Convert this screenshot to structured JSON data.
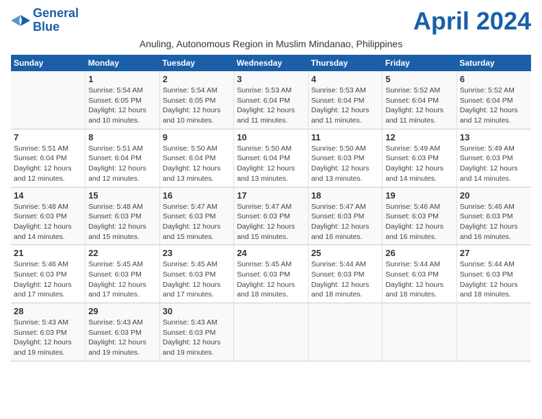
{
  "header": {
    "logo_line1": "General",
    "logo_line2": "Blue",
    "month_title": "April 2024",
    "subtitle": "Anuling, Autonomous Region in Muslim Mindanao, Philippines"
  },
  "weekdays": [
    "Sunday",
    "Monday",
    "Tuesday",
    "Wednesday",
    "Thursday",
    "Friday",
    "Saturday"
  ],
  "weeks": [
    [
      {
        "day": "",
        "sunrise": "",
        "sunset": "",
        "daylight": ""
      },
      {
        "day": "1",
        "sunrise": "Sunrise: 5:54 AM",
        "sunset": "Sunset: 6:05 PM",
        "daylight": "Daylight: 12 hours and 10 minutes."
      },
      {
        "day": "2",
        "sunrise": "Sunrise: 5:54 AM",
        "sunset": "Sunset: 6:05 PM",
        "daylight": "Daylight: 12 hours and 10 minutes."
      },
      {
        "day": "3",
        "sunrise": "Sunrise: 5:53 AM",
        "sunset": "Sunset: 6:04 PM",
        "daylight": "Daylight: 12 hours and 11 minutes."
      },
      {
        "day": "4",
        "sunrise": "Sunrise: 5:53 AM",
        "sunset": "Sunset: 6:04 PM",
        "daylight": "Daylight: 12 hours and 11 minutes."
      },
      {
        "day": "5",
        "sunrise": "Sunrise: 5:52 AM",
        "sunset": "Sunset: 6:04 PM",
        "daylight": "Daylight: 12 hours and 11 minutes."
      },
      {
        "day": "6",
        "sunrise": "Sunrise: 5:52 AM",
        "sunset": "Sunset: 6:04 PM",
        "daylight": "Daylight: 12 hours and 12 minutes."
      }
    ],
    [
      {
        "day": "7",
        "sunrise": "Sunrise: 5:51 AM",
        "sunset": "Sunset: 6:04 PM",
        "daylight": "Daylight: 12 hours and 12 minutes."
      },
      {
        "day": "8",
        "sunrise": "Sunrise: 5:51 AM",
        "sunset": "Sunset: 6:04 PM",
        "daylight": "Daylight: 12 hours and 12 minutes."
      },
      {
        "day": "9",
        "sunrise": "Sunrise: 5:50 AM",
        "sunset": "Sunset: 6:04 PM",
        "daylight": "Daylight: 12 hours and 13 minutes."
      },
      {
        "day": "10",
        "sunrise": "Sunrise: 5:50 AM",
        "sunset": "Sunset: 6:04 PM",
        "daylight": "Daylight: 12 hours and 13 minutes."
      },
      {
        "day": "11",
        "sunrise": "Sunrise: 5:50 AM",
        "sunset": "Sunset: 6:03 PM",
        "daylight": "Daylight: 12 hours and 13 minutes."
      },
      {
        "day": "12",
        "sunrise": "Sunrise: 5:49 AM",
        "sunset": "Sunset: 6:03 PM",
        "daylight": "Daylight: 12 hours and 14 minutes."
      },
      {
        "day": "13",
        "sunrise": "Sunrise: 5:49 AM",
        "sunset": "Sunset: 6:03 PM",
        "daylight": "Daylight: 12 hours and 14 minutes."
      }
    ],
    [
      {
        "day": "14",
        "sunrise": "Sunrise: 5:48 AM",
        "sunset": "Sunset: 6:03 PM",
        "daylight": "Daylight: 12 hours and 14 minutes."
      },
      {
        "day": "15",
        "sunrise": "Sunrise: 5:48 AM",
        "sunset": "Sunset: 6:03 PM",
        "daylight": "Daylight: 12 hours and 15 minutes."
      },
      {
        "day": "16",
        "sunrise": "Sunrise: 5:47 AM",
        "sunset": "Sunset: 6:03 PM",
        "daylight": "Daylight: 12 hours and 15 minutes."
      },
      {
        "day": "17",
        "sunrise": "Sunrise: 5:47 AM",
        "sunset": "Sunset: 6:03 PM",
        "daylight": "Daylight: 12 hours and 15 minutes."
      },
      {
        "day": "18",
        "sunrise": "Sunrise: 5:47 AM",
        "sunset": "Sunset: 6:03 PM",
        "daylight": "Daylight: 12 hours and 16 minutes."
      },
      {
        "day": "19",
        "sunrise": "Sunrise: 5:46 AM",
        "sunset": "Sunset: 6:03 PM",
        "daylight": "Daylight: 12 hours and 16 minutes."
      },
      {
        "day": "20",
        "sunrise": "Sunrise: 5:46 AM",
        "sunset": "Sunset: 6:03 PM",
        "daylight": "Daylight: 12 hours and 16 minutes."
      }
    ],
    [
      {
        "day": "21",
        "sunrise": "Sunrise: 5:46 AM",
        "sunset": "Sunset: 6:03 PM",
        "daylight": "Daylight: 12 hours and 17 minutes."
      },
      {
        "day": "22",
        "sunrise": "Sunrise: 5:45 AM",
        "sunset": "Sunset: 6:03 PM",
        "daylight": "Daylight: 12 hours and 17 minutes."
      },
      {
        "day": "23",
        "sunrise": "Sunrise: 5:45 AM",
        "sunset": "Sunset: 6:03 PM",
        "daylight": "Daylight: 12 hours and 17 minutes."
      },
      {
        "day": "24",
        "sunrise": "Sunrise: 5:45 AM",
        "sunset": "Sunset: 6:03 PM",
        "daylight": "Daylight: 12 hours and 18 minutes."
      },
      {
        "day": "25",
        "sunrise": "Sunrise: 5:44 AM",
        "sunset": "Sunset: 6:03 PM",
        "daylight": "Daylight: 12 hours and 18 minutes."
      },
      {
        "day": "26",
        "sunrise": "Sunrise: 5:44 AM",
        "sunset": "Sunset: 6:03 PM",
        "daylight": "Daylight: 12 hours and 18 minutes."
      },
      {
        "day": "27",
        "sunrise": "Sunrise: 5:44 AM",
        "sunset": "Sunset: 6:03 PM",
        "daylight": "Daylight: 12 hours and 18 minutes."
      }
    ],
    [
      {
        "day": "28",
        "sunrise": "Sunrise: 5:43 AM",
        "sunset": "Sunset: 6:03 PM",
        "daylight": "Daylight: 12 hours and 19 minutes."
      },
      {
        "day": "29",
        "sunrise": "Sunrise: 5:43 AM",
        "sunset": "Sunset: 6:03 PM",
        "daylight": "Daylight: 12 hours and 19 minutes."
      },
      {
        "day": "30",
        "sunrise": "Sunrise: 5:43 AM",
        "sunset": "Sunset: 6:03 PM",
        "daylight": "Daylight: 12 hours and 19 minutes."
      },
      {
        "day": "",
        "sunrise": "",
        "sunset": "",
        "daylight": ""
      },
      {
        "day": "",
        "sunrise": "",
        "sunset": "",
        "daylight": ""
      },
      {
        "day": "",
        "sunrise": "",
        "sunset": "",
        "daylight": ""
      },
      {
        "day": "",
        "sunrise": "",
        "sunset": "",
        "daylight": ""
      }
    ]
  ]
}
